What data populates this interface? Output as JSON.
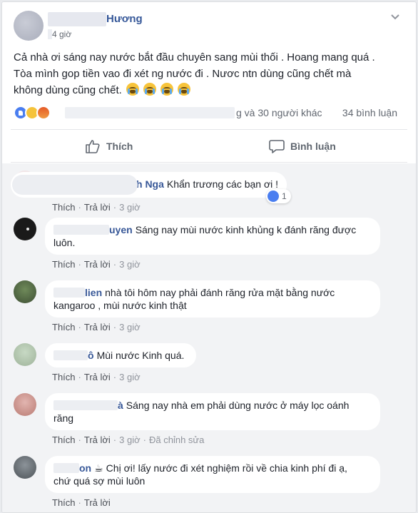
{
  "post": {
    "author_name": "Hương",
    "time": "4 giờ",
    "text_lines": [
      "Cả nhà ơi sáng nay nước bắt đầu chuyên sang mùi thối . Hoang mang quá .",
      "Tòa mình gop tiền vao đi xét ng nước đi . Nươc ntn dùng cũng chết mà",
      "không dùng cũng chết."
    ],
    "reactors_suffix": "g và 30 người khác",
    "comment_count": "34 bình luận"
  },
  "actions": {
    "like": "Thích",
    "comment": "Bình luận"
  },
  "comment_labels": {
    "like": "Thích",
    "reply": "Trả lời",
    "dot": "·"
  },
  "comments": [
    {
      "name": "h Nga",
      "text": "Khẩn trương các bạn ơi !",
      "text2": "",
      "time": "3 giờ",
      "likes": "1",
      "edited": ""
    },
    {
      "name": "uyen",
      "text": "Sáng nay mùi nước kinh khủng k đánh răng được",
      "text2": "luôn.",
      "time": "3 giờ",
      "edited": ""
    },
    {
      "name": "lien",
      "text": "nhà tôi hôm nay phải đánh răng rửa mặt bằng nước",
      "text2": "kangaroo , mùi nước kinh thật",
      "time": "3 giờ",
      "edited": ""
    },
    {
      "name": "ô",
      "text": "Mùi nước Kinh quá.",
      "text2": "",
      "time": "3 giờ",
      "edited": ""
    },
    {
      "name": "à",
      "text": "Sáng nay nhà em phải dùng nước ở máy lọc oánh",
      "text2": "răng",
      "time": "3 giờ",
      "edited": "Đã chỉnh sửa"
    },
    {
      "name": "on",
      "text": "Chị ơi! lấy nước đi xét nghiệm rồi về chia kinh phí đi ạ,",
      "text2": "chứ quá sợ mùi luôn",
      "time": "",
      "edited": ""
    }
  ],
  "colors": {
    "link_blue": "#385898",
    "like_blue": "#4a7ef0",
    "background": "#e9ebee",
    "comment_bg": "#f2f3f5"
  }
}
